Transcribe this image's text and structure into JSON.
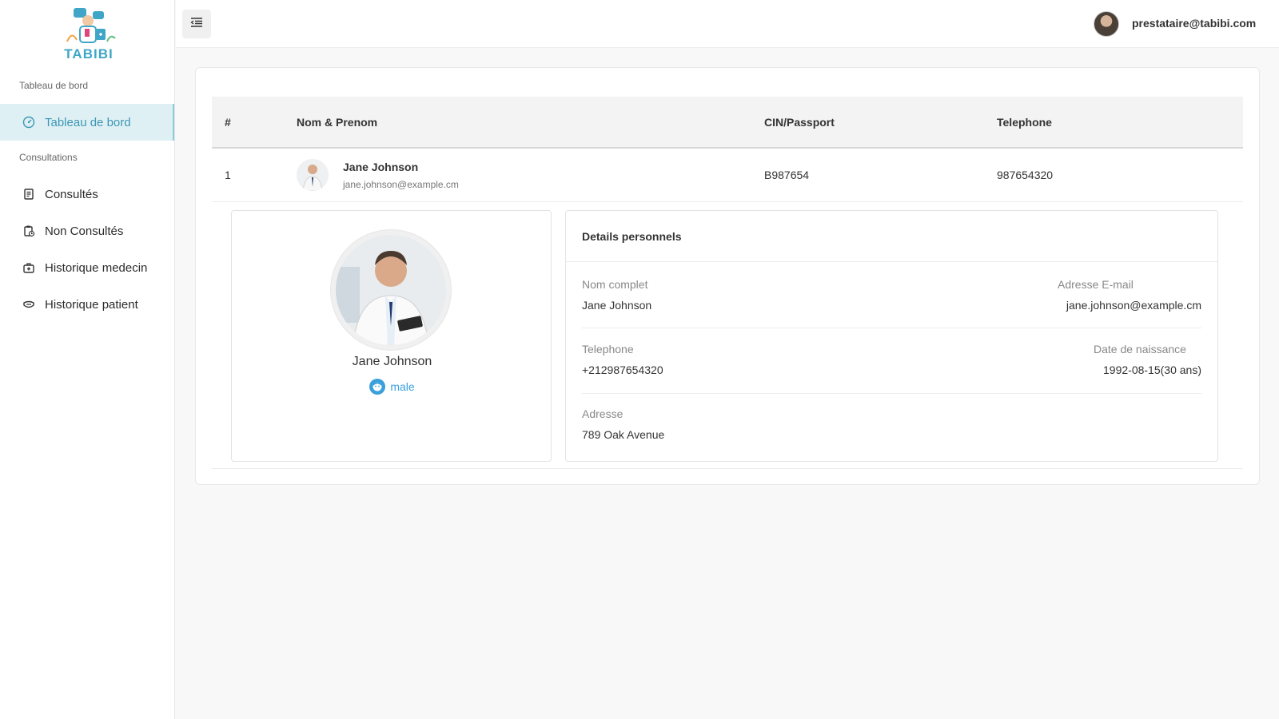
{
  "brand": {
    "name": "TABIBI"
  },
  "sidebar": {
    "sections": [
      {
        "label": "Tableau de bord"
      },
      {
        "label": "Consultations"
      }
    ],
    "items": [
      {
        "label": "Tableau de bord",
        "icon": "dashboard-icon",
        "active": true
      },
      {
        "label": "Consultés",
        "icon": "document-icon"
      },
      {
        "label": "Non Consultés",
        "icon": "clipboard-clock-icon"
      },
      {
        "label": "Historique medecin",
        "icon": "medical-kit-icon"
      },
      {
        "label": "Historique patient",
        "icon": "mask-icon"
      }
    ]
  },
  "topbar": {
    "user_email": "prestataire@tabibi.com"
  },
  "table": {
    "headers": [
      "#",
      "Nom & Prenom",
      "CIN/Passport",
      "Telephone"
    ],
    "rows": [
      {
        "index": "1",
        "name": "Jane Johnson",
        "email": "jane.johnson@example.cm",
        "cin": "B987654",
        "phone": "987654320"
      }
    ]
  },
  "profile": {
    "name": "Jane Johnson",
    "gender": "male"
  },
  "details": {
    "title": "Details personnels",
    "full_name_label": "Nom complet",
    "full_name": "Jane Johnson",
    "email_label": "Adresse E-mail",
    "email": "jane.johnson@example.cm",
    "phone_label": "Telephone",
    "phone": "+212987654320",
    "birth_label": "Date de naissance",
    "birth": "1992-08-15(30 ans)",
    "address_label": "Adresse",
    "address": "789 Oak Avenue"
  },
  "colors": {
    "accent": "#3c97b3",
    "active_bg": "#dff0f5",
    "gender_blue": "#3aa0dc"
  }
}
